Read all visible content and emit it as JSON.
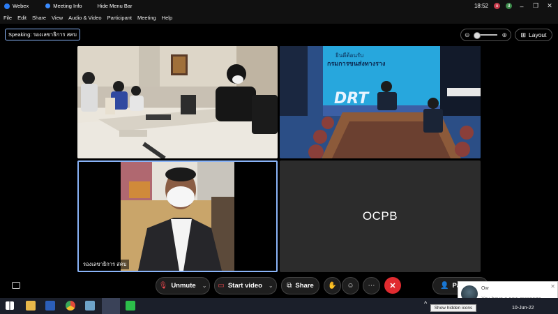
{
  "titlebar": {
    "app_name": "Webex",
    "meeting_info": "Meeting Info",
    "hide_menu": "Hide Menu Bar",
    "time": "18:52",
    "avatar1": "o",
    "avatar2": "d"
  },
  "menu": [
    "File",
    "Edit",
    "Share",
    "View",
    "Audio & Video",
    "Participant",
    "Meeting",
    "Help"
  ],
  "speaking": "Speaking: รองเลขาธิการ สคบ",
  "layout_label": "Layout",
  "tiles": {
    "tile3_name": "รองเลขาธิการ สคบ",
    "tile4_name": "OCPB",
    "banner_line1": "ยินดีต้อนรับ",
    "banner_line2": "กรมการขนส่งทางราง",
    "banner_logo": "DRT"
  },
  "controls": {
    "unmute": "Unmute",
    "start_video": "Start video",
    "share": "Share",
    "participants": "Pa"
  },
  "notification": {
    "name": "Ow",
    "message": "You have a new message."
  },
  "taskbar": {
    "tooltip": "Show hidden icons",
    "date": "10-Jun-22"
  },
  "colors": {
    "accent": "#8ab4f8",
    "leave": "#e02b30",
    "muted": "#e8484e"
  }
}
